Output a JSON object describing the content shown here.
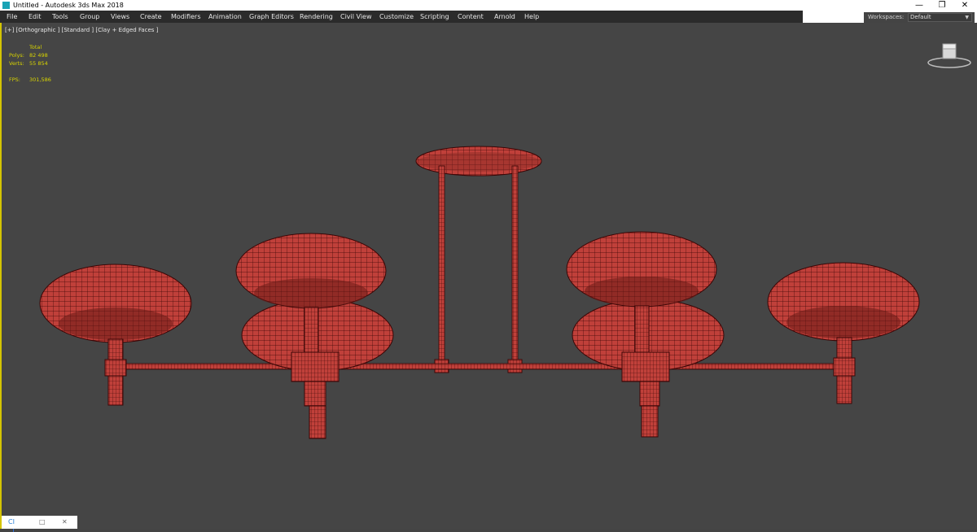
{
  "window": {
    "title": "Untitled - Autodesk 3ds Max 2018",
    "controls": {
      "minimize": "—",
      "restore": "❐",
      "close": "✕"
    }
  },
  "menu": [
    "File",
    "Edit",
    "Tools",
    "Group",
    "Views",
    "Create",
    "Modifiers",
    "Animation",
    "Graph Editors",
    "Rendering",
    "Civil View",
    "Customize",
    "Scripting",
    "Content",
    "Arnold",
    "Help"
  ],
  "workspaces": {
    "label": "Workspaces:",
    "value": "Default"
  },
  "viewport": {
    "label": "[+] [Orthographic ] [Standard ] [Clay + Edged Faces ]",
    "stats": {
      "total_label": "Total",
      "polys_label": "Polys:",
      "polys_value": "82 498",
      "verts_label": "Verts:",
      "verts_value": "55 854",
      "fps_label": "FPS:",
      "fps_value": "301,586"
    }
  },
  "bottom_tabs": {
    "tab1": "CI",
    "tab2": "□",
    "tab3": "✕"
  },
  "colors": {
    "viewport_bg": "#454545",
    "model": "#c0403a",
    "wire": "#3a0606",
    "stats": "#d8d400",
    "active_border": "#d4c400"
  }
}
